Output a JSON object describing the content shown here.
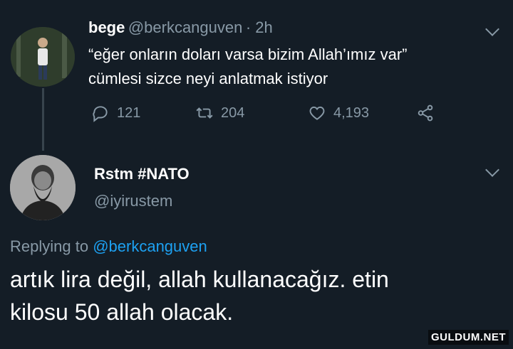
{
  "tweet1": {
    "name": "bege",
    "handle": "@berkcanguven",
    "time": "· 2h",
    "text_line1": "“eğer onların doları varsa bizim Allah’ımız var”",
    "text_line2": "cümlesi sizce neyi anlatmak istiyor",
    "replies": "121",
    "retweets": "204",
    "likes": "4,193"
  },
  "tweet2": {
    "name": "Rstm #NATO",
    "handle": "@iyirustem",
    "replying_prefix": "Replying to",
    "replying_mention": "@berkcanguven",
    "text_line1": "artık lira değil, allah kullanacağız. etin",
    "text_line2": "kilosu 50 allah olacak."
  },
  "icons": {
    "reply": "reply-icon",
    "retweet": "retweet-icon",
    "like": "heart-icon",
    "share": "share-icon",
    "menu": "chevron-down-icon"
  },
  "colors": {
    "background": "#141d26",
    "secondary_text": "#8899a6",
    "link": "#1da1f2"
  },
  "watermark": "GULDUM.NET"
}
